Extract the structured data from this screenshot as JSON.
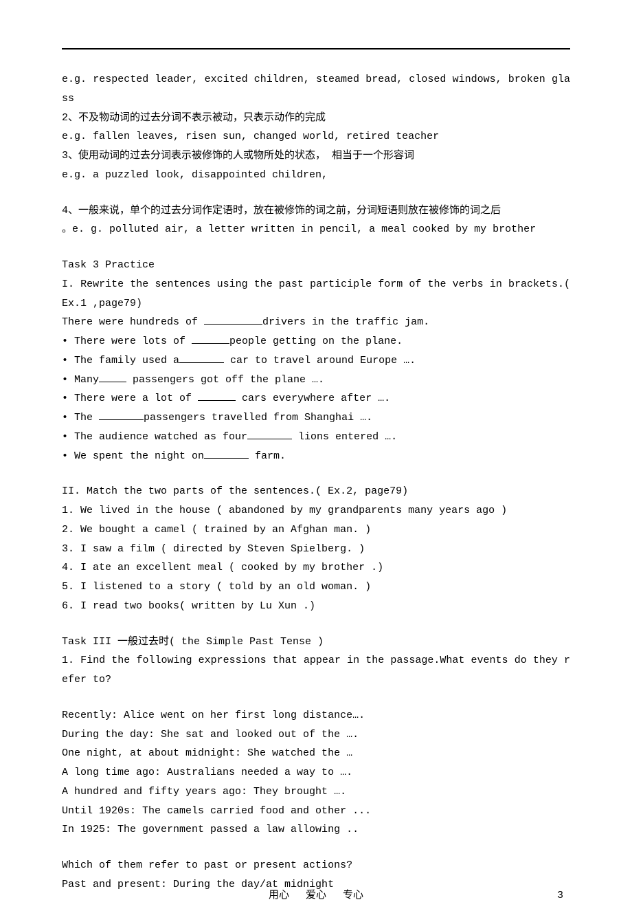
{
  "lines": {
    "l1": "e.g. respected leader, excited children, steamed bread, closed windows, broken glass",
    "l2": "2、不及物动词的过去分词不表示被动，只表示动作的完成",
    "l3": "e.g. fallen leaves, risen sun, changed world, retired teacher",
    "l4": "3、使用动词的过去分词表示被修饰的人或物所处的状态， 相当于一个形容词",
    "l5": "e.g. a puzzled look, disappointed children,",
    "l6": "4、一般来说，单个的过去分词作定语时，放在被修饰的词之前，分词短语则放在被修饰的词之后",
    "l7": "。e. g. polluted air, a letter written in pencil, a meal cooked by my brother",
    "l8": "Task 3 Practice",
    "l9": "I. Rewrite the sentences using the past participle form of the verbs in brackets.( Ex.1 ,page79)",
    "ex1_a1": "There were hundreds of ",
    "ex1_a2": "drivers in the traffic jam.",
    "ex1_b1": "• There were lots of ",
    "ex1_b2": "people getting on the plane.",
    "ex1_c1": "• The family used a",
    "ex1_c2": " car to travel around Europe ….",
    "ex1_d1": "• Many",
    "ex1_d2": " passengers got off the plane ….",
    "ex1_e1": "• There were a lot of ",
    "ex1_e2": " cars everywhere after ….",
    "ex1_f1": "• The ",
    "ex1_f2": "passengers travelled from Shanghai ….",
    "ex1_g1": "• The audience watched as four",
    "ex1_g2": " lions entered ….",
    "ex1_h1": "• We spent the night on",
    "ex1_h2": " farm.",
    "l10": "II. Match the two parts of the sentences.( Ex.2, page79)",
    "m1": "1. We lived in the house ( abandoned by my grandparents many years ago )",
    "m2": "2. We bought a camel ( trained by an Afghan man. )",
    "m3": "3. I saw a film ( directed by Steven Spielberg. )",
    "m4": "4. I ate an excellent meal ( cooked by my brother .)",
    "m5": "5. I listened to a story ( told by an old woman. )",
    "m6": "6. I read two books( written by Lu Xun .)",
    "t3": "Task III 一般过去时( the Simple Past Tense )",
    "t3q": "1. Find the following expressions that appear in the passage.What events do they refer to?",
    "r1": "Recently: Alice went on her first long distance….",
    "r2": "During the day: She sat and looked out of the ….",
    "r3": "One night, at about midnight: She watched the …",
    "r4": "A long time ago: Australians needed a way to ….",
    "r5": "A hundred and fifty years ago: They brought ….",
    "r6": "Until 1920s: The camels carried food and other ...",
    "r7": "In 1925: The government passed a law allowing ..",
    "q2": "Which of them refer to past or present actions?",
    "q2a": "Past and present: During the day/at midnight"
  },
  "footer": {
    "a": "用心",
    "b": "爱心",
    "c": "专心",
    "page": "3"
  }
}
